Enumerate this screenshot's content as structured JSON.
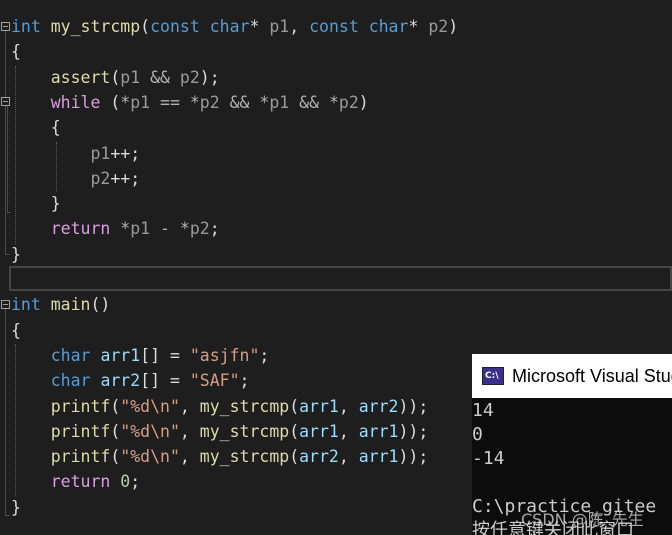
{
  "editor": {
    "lines": [
      [
        {
          "t": "int",
          "c": "kw"
        },
        {
          "t": " ",
          "c": "punc"
        },
        {
          "t": "my_strcmp",
          "c": "fn"
        },
        {
          "t": "(",
          "c": "punc"
        },
        {
          "t": "const",
          "c": "kw"
        },
        {
          "t": " ",
          "c": "punc"
        },
        {
          "t": "char",
          "c": "kw"
        },
        {
          "t": "* ",
          "c": "punc"
        },
        {
          "t": "p1",
          "c": "param"
        },
        {
          "t": ", ",
          "c": "punc"
        },
        {
          "t": "const",
          "c": "kw"
        },
        {
          "t": " ",
          "c": "punc"
        },
        {
          "t": "char",
          "c": "kw"
        },
        {
          "t": "* ",
          "c": "punc"
        },
        {
          "t": "p2",
          "c": "param"
        },
        {
          "t": ")",
          "c": "punc"
        }
      ],
      [
        {
          "t": "{",
          "c": "punc"
        }
      ],
      [
        {
          "t": "    ",
          "c": "punc"
        },
        {
          "t": "assert",
          "c": "fn"
        },
        {
          "t": "(",
          "c": "punc"
        },
        {
          "t": "p1",
          "c": "param"
        },
        {
          "t": " && ",
          "c": "op"
        },
        {
          "t": "p2",
          "c": "param"
        },
        {
          "t": ");",
          "c": "punc"
        }
      ],
      [
        {
          "t": "    ",
          "c": "punc"
        },
        {
          "t": "while",
          "c": "ctl"
        },
        {
          "t": " (",
          "c": "punc"
        },
        {
          "t": "*",
          "c": "op"
        },
        {
          "t": "p1",
          "c": "param"
        },
        {
          "t": " == ",
          "c": "op"
        },
        {
          "t": "*",
          "c": "op"
        },
        {
          "t": "p2",
          "c": "param"
        },
        {
          "t": " && ",
          "c": "op"
        },
        {
          "t": "*",
          "c": "op"
        },
        {
          "t": "p1",
          "c": "param"
        },
        {
          "t": " && ",
          "c": "op"
        },
        {
          "t": "*",
          "c": "op"
        },
        {
          "t": "p2",
          "c": "param"
        },
        {
          "t": ")",
          "c": "punc"
        }
      ],
      [
        {
          "t": "    {",
          "c": "punc"
        }
      ],
      [
        {
          "t": "        ",
          "c": "punc"
        },
        {
          "t": "p1",
          "c": "param"
        },
        {
          "t": "++;",
          "c": "punc"
        }
      ],
      [
        {
          "t": "        ",
          "c": "punc"
        },
        {
          "t": "p2",
          "c": "param"
        },
        {
          "t": "++;",
          "c": "punc"
        }
      ],
      [
        {
          "t": "    }",
          "c": "punc"
        }
      ],
      [
        {
          "t": "    ",
          "c": "punc"
        },
        {
          "t": "return",
          "c": "ctl"
        },
        {
          "t": " ",
          "c": "punc"
        },
        {
          "t": "*",
          "c": "op"
        },
        {
          "t": "p1",
          "c": "param"
        },
        {
          "t": " - ",
          "c": "op"
        },
        {
          "t": "*",
          "c": "op"
        },
        {
          "t": "p2",
          "c": "param"
        },
        {
          "t": ";",
          "c": "punc"
        }
      ],
      [
        {
          "t": "}",
          "c": "punc"
        }
      ],
      [],
      [
        {
          "t": "int",
          "c": "kw"
        },
        {
          "t": " ",
          "c": "punc"
        },
        {
          "t": "main",
          "c": "fn"
        },
        {
          "t": "()",
          "c": "punc"
        }
      ],
      [
        {
          "t": "{",
          "c": "punc"
        }
      ],
      [
        {
          "t": "    ",
          "c": "punc"
        },
        {
          "t": "char",
          "c": "kw"
        },
        {
          "t": " ",
          "c": "punc"
        },
        {
          "t": "arr1",
          "c": "var"
        },
        {
          "t": "[] = ",
          "c": "punc"
        },
        {
          "t": "\"asjfn\"",
          "c": "str"
        },
        {
          "t": ";",
          "c": "punc"
        }
      ],
      [
        {
          "t": "    ",
          "c": "punc"
        },
        {
          "t": "char",
          "c": "kw"
        },
        {
          "t": " ",
          "c": "punc"
        },
        {
          "t": "arr2",
          "c": "var"
        },
        {
          "t": "[] = ",
          "c": "punc"
        },
        {
          "t": "\"SAF\"",
          "c": "str"
        },
        {
          "t": ";",
          "c": "punc"
        }
      ],
      [
        {
          "t": "    ",
          "c": "punc"
        },
        {
          "t": "printf",
          "c": "fn"
        },
        {
          "t": "(",
          "c": "punc"
        },
        {
          "t": "\"%d\\n\"",
          "c": "str"
        },
        {
          "t": ", ",
          "c": "punc"
        },
        {
          "t": "my_strcmp",
          "c": "fn"
        },
        {
          "t": "(",
          "c": "punc"
        },
        {
          "t": "arr1",
          "c": "var"
        },
        {
          "t": ", ",
          "c": "punc"
        },
        {
          "t": "arr2",
          "c": "var"
        },
        {
          "t": "));",
          "c": "punc"
        }
      ],
      [
        {
          "t": "    ",
          "c": "punc"
        },
        {
          "t": "printf",
          "c": "fn"
        },
        {
          "t": "(",
          "c": "punc"
        },
        {
          "t": "\"%d\\n\"",
          "c": "str"
        },
        {
          "t": ", ",
          "c": "punc"
        },
        {
          "t": "my_strcmp",
          "c": "fn"
        },
        {
          "t": "(",
          "c": "punc"
        },
        {
          "t": "arr1",
          "c": "var"
        },
        {
          "t": ", ",
          "c": "punc"
        },
        {
          "t": "arr1",
          "c": "var"
        },
        {
          "t": "));",
          "c": "punc"
        }
      ],
      [
        {
          "t": "    ",
          "c": "punc"
        },
        {
          "t": "printf",
          "c": "fn"
        },
        {
          "t": "(",
          "c": "punc"
        },
        {
          "t": "\"%d\\n\"",
          "c": "str"
        },
        {
          "t": ", ",
          "c": "punc"
        },
        {
          "t": "my_strcmp",
          "c": "fn"
        },
        {
          "t": "(",
          "c": "punc"
        },
        {
          "t": "arr2",
          "c": "var"
        },
        {
          "t": ", ",
          "c": "punc"
        },
        {
          "t": "arr1",
          "c": "var"
        },
        {
          "t": "));",
          "c": "punc"
        }
      ],
      [
        {
          "t": "    ",
          "c": "punc"
        },
        {
          "t": "return",
          "c": "ctl"
        },
        {
          "t": " ",
          "c": "punc"
        },
        {
          "t": "0",
          "c": "num"
        },
        {
          "t": ";",
          "c": "punc"
        }
      ],
      [
        {
          "t": "}",
          "c": "punc"
        }
      ]
    ]
  },
  "console": {
    "title": "Microsoft Visual Studio 调试控制台",
    "icon_label": "C:\\",
    "output": [
      "14",
      "0",
      "-14",
      "",
      "C:\\practice_gitee",
      "按任意键关闭此窗口"
    ],
    "watermark": "CSDN @陈_先生"
  },
  "colors": {
    "keyword": "#569cd6",
    "control": "#d8a0df",
    "function": "#dcdcaa",
    "string": "#d69d85",
    "number": "#b5cea8",
    "variable": "#9cdcfe",
    "parameter": "#9a9a9a",
    "background": "#1e1e1e"
  }
}
